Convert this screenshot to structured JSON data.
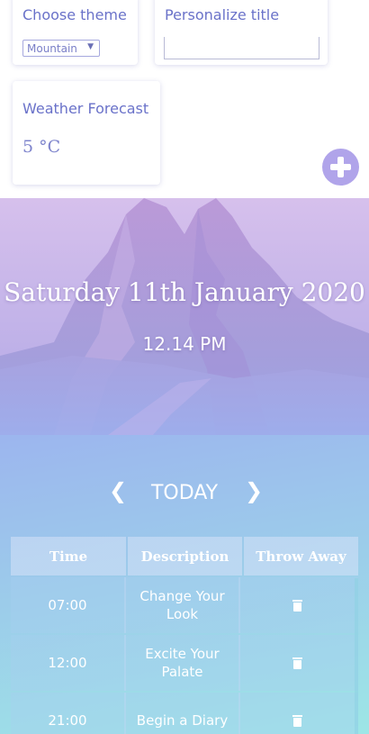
{
  "settings": {
    "theme_label": "Choose theme",
    "theme_value": "Mountain",
    "title_label": "Personalize title",
    "title_value": "",
    "weather_label": "Weather Forecast",
    "temperature": "5 °C"
  },
  "hero": {
    "date": "Saturday 11th January 2020",
    "time": "12.14 PM"
  },
  "day_nav": {
    "prev": "❮",
    "label": "TODAY",
    "next": "❯"
  },
  "table": {
    "headers": [
      "Time",
      "Description",
      "Throw Away"
    ],
    "rows": [
      {
        "time": "07:00",
        "description": "Change Your Look"
      },
      {
        "time": "12:00",
        "description": "Excite Your Palate"
      },
      {
        "time": "21:00",
        "description": "Begin a Diary"
      }
    ]
  },
  "icons": {
    "add": "plus-circle-icon",
    "delete": "trash-icon",
    "dropdown": "caret-down-icon"
  },
  "colors": {
    "accent": "#6a72c9",
    "add_button": "#b0a4ea",
    "text_light": "#ffffff"
  }
}
